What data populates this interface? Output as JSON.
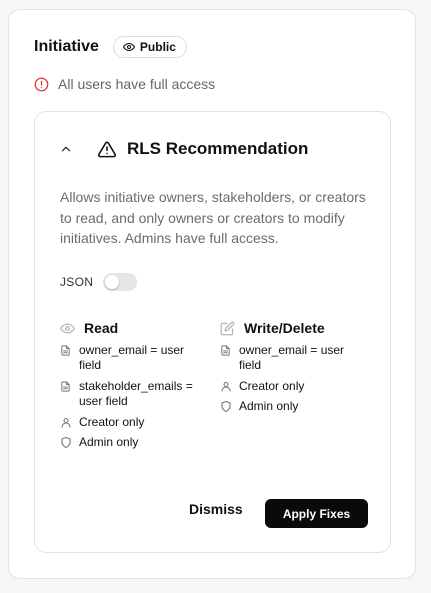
{
  "panel": {
    "title": "Initiative",
    "badge_label": "Public",
    "access_text": "All users have full access"
  },
  "recommendation": {
    "title": "RLS Recommendation",
    "description": "Allows initiative owners, stakeholders, or creators to read, and only owners or creators to modify initiatives. Admins have full access.",
    "json_label": "JSON",
    "json_enabled": false,
    "read": {
      "title": "Read",
      "rules": [
        {
          "icon": "document-icon",
          "text": "owner_email = user field"
        },
        {
          "icon": "document-icon",
          "text": "stakeholder_emails = user field"
        },
        {
          "icon": "user-icon",
          "text": "Creator only"
        },
        {
          "icon": "shield-icon",
          "text": "Admin only"
        }
      ]
    },
    "write": {
      "title": "Write/Delete",
      "rules": [
        {
          "icon": "document-icon",
          "text": "owner_email = user field"
        },
        {
          "icon": "user-icon",
          "text": "Creator only"
        },
        {
          "icon": "shield-icon",
          "text": "Admin only"
        }
      ]
    },
    "dismiss_label": "Dismiss",
    "apply_label": "Apply Fixes"
  },
  "colors": {
    "error": "#e0303a",
    "primary_button": "#0a0a0a",
    "muted_text": "#6b6b72"
  }
}
